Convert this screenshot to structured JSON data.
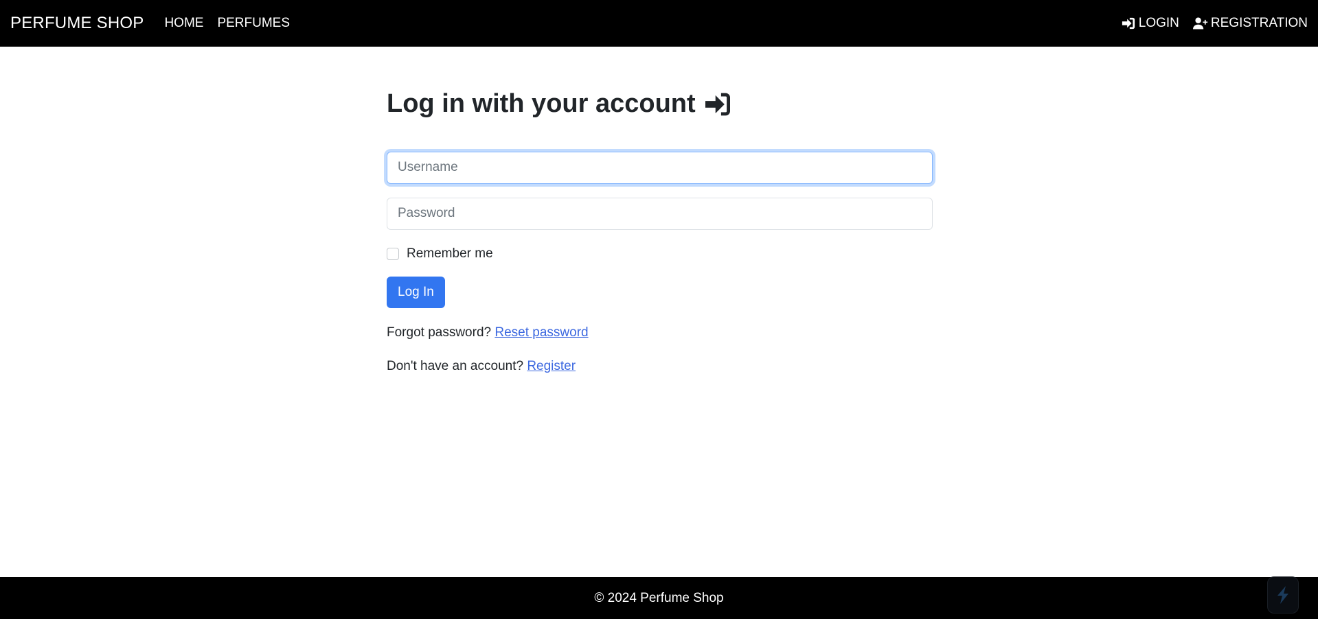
{
  "navbar": {
    "brand": "PERFUME SHOP",
    "links": [
      "HOME",
      "PERFUMES"
    ],
    "login_label": "LOGIN",
    "login_icon": "sign-in-icon",
    "registration_label": "REGISTRATION",
    "registration_icon": "user-plus-icon"
  },
  "form": {
    "title": "Log in with your account",
    "title_icon": "sign-in-icon",
    "username_placeholder": "Username",
    "username_value": "",
    "password_placeholder": "Password",
    "password_value": "",
    "remember_label": "Remember me",
    "remember_checked": false,
    "submit_label": "Log In",
    "forgot_text": "Forgot password?",
    "reset_link": "Reset password",
    "no_account_text": "Don't have an account?",
    "register_link": "Register"
  },
  "footer": {
    "text": "© 2024 Perfume Shop"
  },
  "colors": {
    "navbar_bg": "#000000",
    "primary": "#3276f0",
    "link": "#3c68e0"
  }
}
